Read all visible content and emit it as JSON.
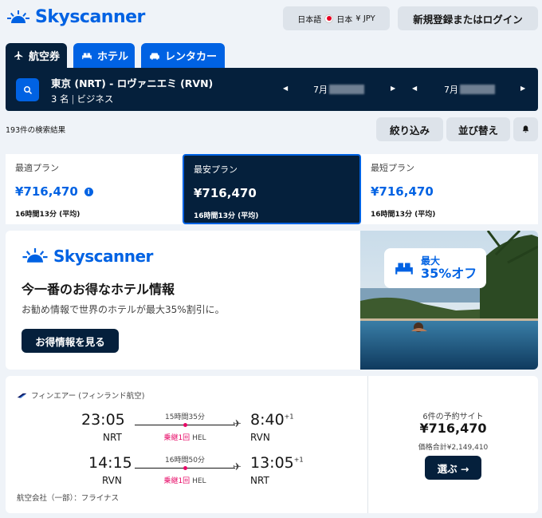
{
  "brand": {
    "name": "Skyscanner",
    "color": "#0062e3"
  },
  "header": {
    "language": "日本語",
    "country": "日本",
    "currency": "¥ JPY",
    "login_label": "新規登録またはログイン"
  },
  "tabs": [
    {
      "label": "航空券",
      "icon": "plane-icon",
      "active": true
    },
    {
      "label": "ホテル",
      "icon": "bed-icon"
    },
    {
      "label": "レンタカー",
      "icon": "car-icon"
    }
  ],
  "search": {
    "route": "東京 (NRT) - ロヴァニエミ (RVN)",
    "passengers": "3 名",
    "cabin": "ビジネス",
    "depart_month": "7月",
    "return_month": "7月"
  },
  "results": {
    "count_text": "193件の検索結果",
    "filter_label": "絞り込み",
    "sort_label": "並び替え"
  },
  "sort_cards": [
    {
      "label": "最適プラン",
      "price": "¥716,470",
      "duration": "16時間13分 (平均)",
      "info": true
    },
    {
      "label": "最安プラン",
      "price": "¥716,470",
      "duration": "16時間13分 (平均)",
      "selected": true
    },
    {
      "label": "最短プラン",
      "price": "¥716,470",
      "duration": "16時間13分 (平均)"
    }
  ],
  "ad": {
    "title": "今一番のお得なホテル情報",
    "subtitle": "お勧め情報で世界のホテルが最大35%割引に。",
    "button_label": "お得情報を見る",
    "badge_top": "最大",
    "badge_main": "35%オフ"
  },
  "flight": {
    "airline": "フィンエアー (フィンランド航空)",
    "outbound": {
      "dep_time": "23:05",
      "dep_code": "NRT",
      "duration": "15時間35分",
      "stops": "乗継1回",
      "via": "HEL",
      "arr_time": "8:40",
      "arr_offset": "+1",
      "arr_code": "RVN"
    },
    "inbound": {
      "dep_time": "14:15",
      "dep_code": "RVN",
      "duration": "16時間50分",
      "stops": "乗継1回",
      "via": "HEL",
      "arr_time": "13:05",
      "arr_offset": "+1",
      "arr_code": "NRT"
    },
    "operated": "航空会社（一部）：フライナス",
    "sites": "6件の予約サイト",
    "price": "¥716,470",
    "total": "価格合計¥2,149,410",
    "select_label": "選ぶ →"
  }
}
